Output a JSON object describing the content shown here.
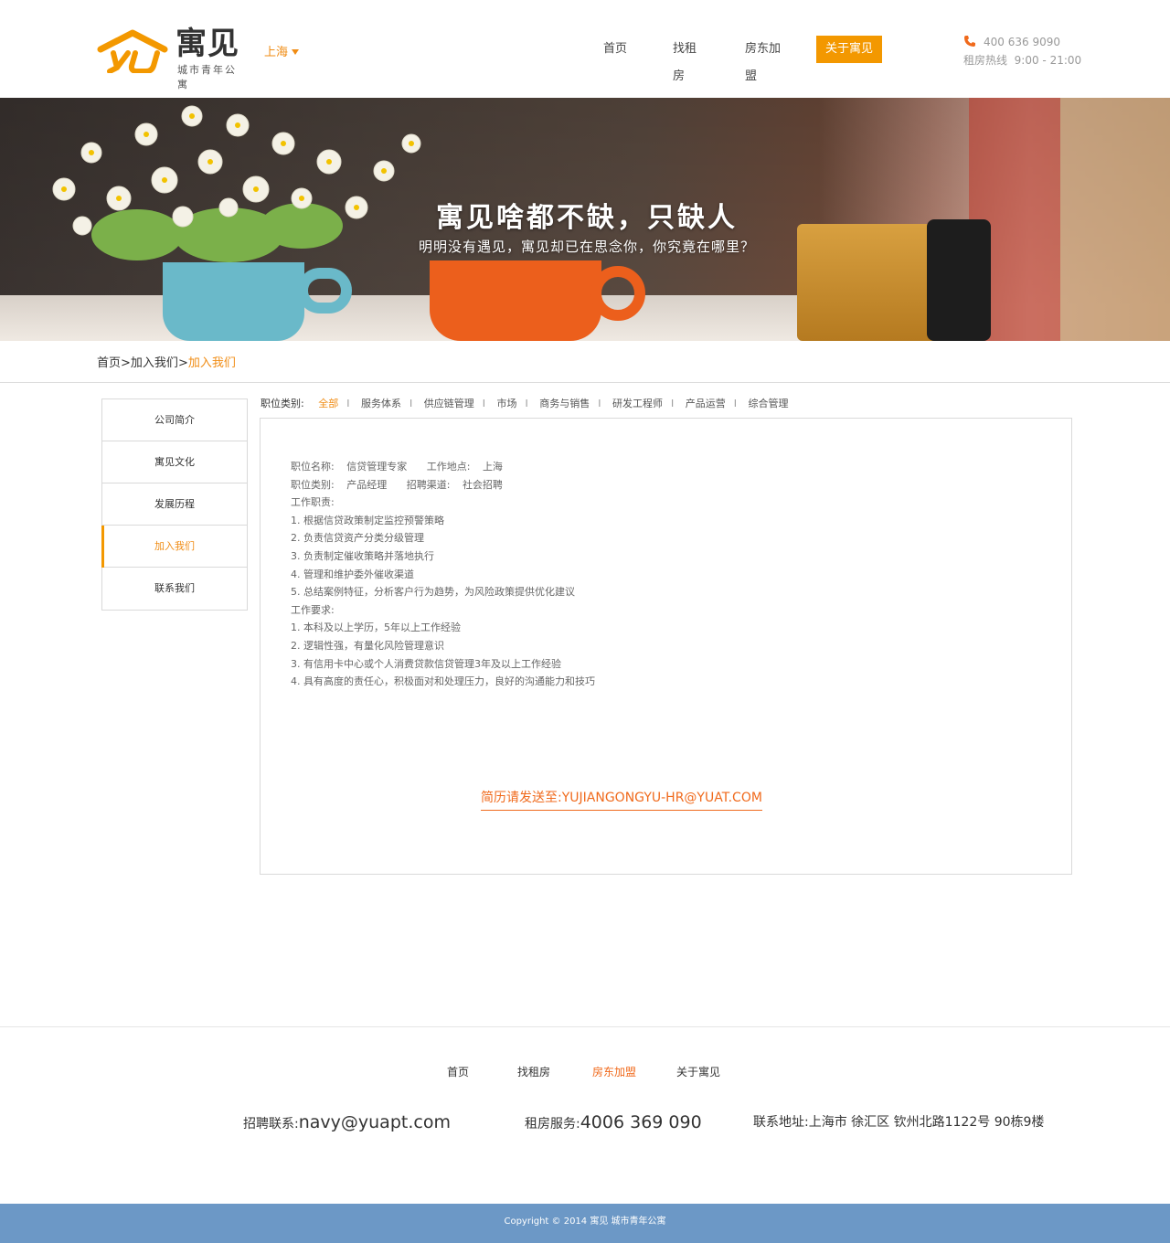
{
  "header": {
    "logo_name": "寓见",
    "logo_sub": "城市青年公寓",
    "city": "上海",
    "nav": [
      "首页",
      "找租房",
      "房东加盟",
      "关于寓见"
    ],
    "phone": "400 636 9090",
    "hotline_label": "租房热线",
    "hotline_hours": "9:00 - 21:00",
    "accent_color": "#f39800"
  },
  "banner": {
    "title": "寓见啥都不缺，只缺人",
    "subtitle": "明明没有遇见，寓见却已在思念你，你究竟在哪里？"
  },
  "breadcrumb": {
    "home": "首页",
    "sep1": ">",
    "parent": "加入我们",
    "sep2": ">",
    "current": "加入我们"
  },
  "sidebar": {
    "items": [
      "公司简介",
      "寓见文化",
      "发展历程",
      "加入我们",
      "联系我们"
    ]
  },
  "filter": {
    "label": "职位类别:",
    "categories": [
      "全部",
      "服务体系",
      "供应链管理",
      "市场",
      "商务与销售",
      "研发工程师",
      "产品运营",
      "综合管理"
    ],
    "separator": "I"
  },
  "job": {
    "name_label": "职位名称:",
    "name_value": "信贷管理专家",
    "location_label": "工作地点:",
    "location_value": "上海",
    "category_label": "职位类别:",
    "category_value": "产品经理",
    "channel_label": "招聘渠道:",
    "channel_value": "社会招聘",
    "duties_label": "工作职责:",
    "duties": [
      "1. 根据信贷政策制定监控预警策略",
      "2. 负责信贷资产分类分级管理",
      "3. 负责制定催收策略并落地执行",
      "4. 管理和维护委外催收渠道",
      "5. 总结案例特征，分析客户行为趋势，为风险政策提供优化建议"
    ],
    "requirements_label": "工作要求:",
    "requirements": [
      "1. 本科及以上学历，5年以上工作经验",
      "2. 逻辑性强，有量化风险管理意识",
      "3. 有信用卡中心或个人消费贷款信贷管理3年及以上工作经验",
      "4. 具有高度的责任心，积极面对和处理压力，良好的沟通能力和技巧"
    ],
    "resume": "简历请发送至:YUJIANGONGYU-HR@YUAT.COM"
  },
  "footer": {
    "nav": [
      "首页",
      "找租房",
      "房东加盟",
      "关于寓见"
    ],
    "recruit_label": "招聘联系:",
    "recruit_value": "navy@yuapt.com",
    "rent_label": "租房服务:",
    "rent_value": "4006 369 090",
    "address_label": "联系地址:",
    "address_value": "上海市 徐汇区 钦州北路1122号 90栋9楼",
    "copyright": "Copyright © 2014 寓见 城市青年公寓"
  }
}
